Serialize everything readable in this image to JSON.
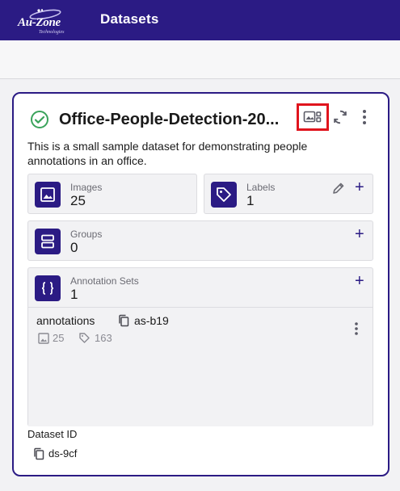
{
  "app": {
    "logo_text": "Au-Zone",
    "logo_sub": "Technologies",
    "page_title": "Datasets"
  },
  "card": {
    "title": "Office-People-Detection-20...",
    "description": "This is a small sample dataset for demonstrating people annotations in an office.",
    "status": "ready",
    "accent_color": "#2b1b84",
    "highlight_color": "#e0141d"
  },
  "tiles": {
    "images": {
      "label": "Images",
      "value": "25"
    },
    "labels": {
      "label": "Labels",
      "value": "1"
    },
    "groups": {
      "label": "Groups",
      "value": "0"
    },
    "annotation_sets": {
      "label": "Annotation Sets",
      "value": "1"
    }
  },
  "annotation_set": {
    "name": "annotations",
    "id": "as-b19",
    "image_count": "25",
    "label_count": "163"
  },
  "dataset": {
    "id_label": "Dataset ID",
    "id": "ds-9cf"
  }
}
